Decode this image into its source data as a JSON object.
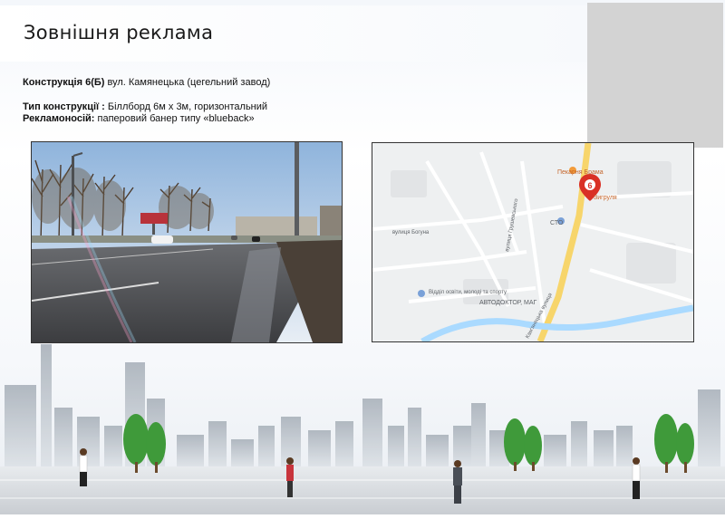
{
  "page": {
    "title": "Зовнішня реклама"
  },
  "info": {
    "construction_label": "Конструкція 6(Б)",
    "construction_value": "вул. Камянецька (цегельний завод)",
    "type_label": "Тип конструкції :",
    "type_value": "Біллборд 6м х 3м, горизонтальний",
    "carrier_label": "Рекламоносій:",
    "carrier_value": "паперовий банер типу «blueback»"
  },
  "map": {
    "marker_number": "6",
    "labels": {
      "bakery": "Пекарня Брама",
      "shop": "Зигруля",
      "sto": "СТО",
      "autodoctor": "АВТОДОКТОР, МАГ",
      "education": "Відділ освіти, молоді та спорту",
      "street_main": "Кам'янецька вулиця",
      "street_hrushevskoho": "вулиця Грушевського",
      "street_bohuna": "вулиця Богуна"
    }
  },
  "colors": {
    "road_main": "#f7d56b",
    "marker": "#d93025",
    "water": "#aadaff"
  }
}
